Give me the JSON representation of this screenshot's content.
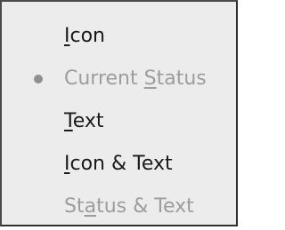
{
  "menu": {
    "items": [
      {
        "pre": "",
        "mn": "I",
        "post": "con",
        "enabled": true,
        "selected": false
      },
      {
        "pre": "Current ",
        "mn": "S",
        "post": "tatus",
        "enabled": false,
        "selected": true
      },
      {
        "pre": "",
        "mn": "T",
        "post": "ext",
        "enabled": true,
        "selected": false
      },
      {
        "pre": "",
        "mn": "I",
        "post": "con & Text",
        "enabled": true,
        "selected": false
      },
      {
        "pre": "St",
        "mn": "a",
        "post": "tus & Text",
        "enabled": false,
        "selected": false
      }
    ],
    "colors": {
      "enabled_text": "#1a1a1a",
      "disabled_text": "#9d9d9d",
      "background": "#ececec",
      "border": "#4a4a4a"
    }
  }
}
